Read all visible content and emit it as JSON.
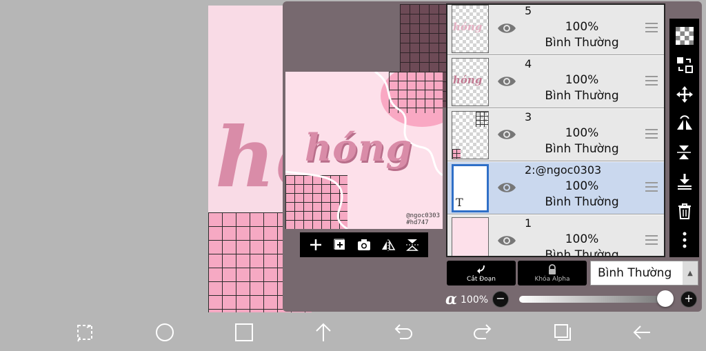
{
  "canvas": {
    "artwork_text": "hóng",
    "credit_lines": [
      "@ngoc0303",
      "#hd747"
    ]
  },
  "layers": [
    {
      "name": "5",
      "opacity": "100%",
      "blend": "Bình Thường",
      "thumb": "text-faded"
    },
    {
      "name": "4",
      "opacity": "100%",
      "blend": "Bình Thường",
      "thumb": "text"
    },
    {
      "name": "3",
      "opacity": "100%",
      "blend": "Bình Thường",
      "thumb": "grid"
    },
    {
      "name": "2:@ngoc0303",
      "opacity": "100%",
      "blend": "Bình Thường",
      "thumb": "type",
      "selected": true
    },
    {
      "name": "1",
      "opacity": "100%",
      "blend": "Bình Thường",
      "thumb": "pink"
    }
  ],
  "thumb_glyphs": {
    "type_layer": "T"
  },
  "controls": {
    "clipping_label": "Cắt Đoạn",
    "alpha_lock_label": "Khóa Alpha",
    "blend_mode": "Bình Thường",
    "alpha_symbol": "α",
    "opacity_value": "100%",
    "minus": "−",
    "plus": "+"
  },
  "opacity_fraction": 1.0,
  "tools": [
    "transparency-grid-icon",
    "layer-swap-icon",
    "move-icon",
    "flip-horizontal-icon",
    "flip-vertical-icon",
    "merge-down-icon",
    "trash-icon",
    "more-vertical-icon"
  ],
  "preview_tools": [
    "add-layer-icon",
    "add-folder-icon",
    "camera-icon",
    "flip-h-icon",
    "flip-v-icon"
  ],
  "bottom_bar": [
    "transform-icon",
    "circle-icon",
    "square-icon",
    "arrow-up-icon",
    "undo-icon",
    "redo-icon",
    "layers-icon",
    "back-icon"
  ],
  "colors": {
    "selected_layer": "#cad8ee",
    "selected_border": "#2f6fc7",
    "artwork_pink": "#d98ca8"
  }
}
